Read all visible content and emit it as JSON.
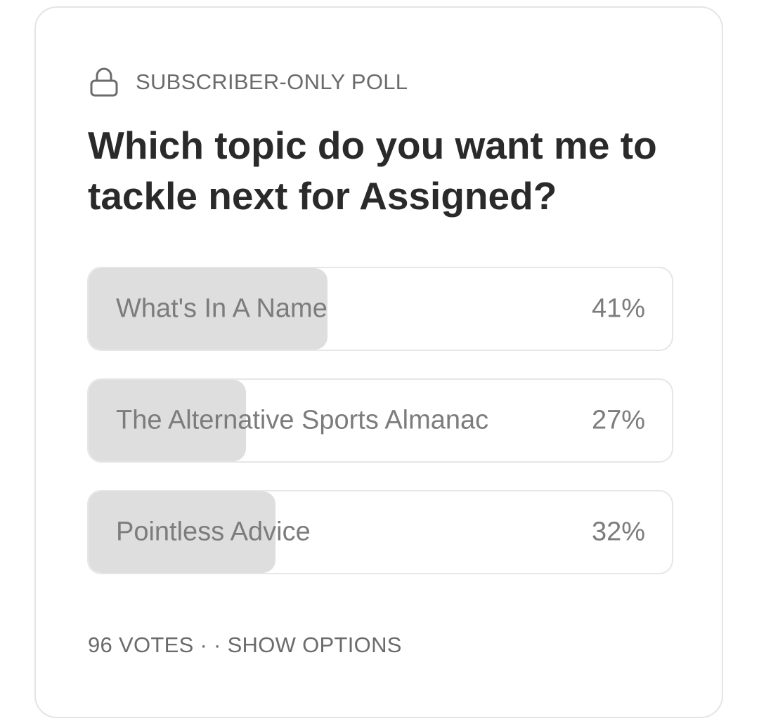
{
  "poll": {
    "label": "SUBSCRIBER-ONLY POLL",
    "lock_icon": "lock-icon",
    "question": "Which topic do you want me to tackle next for Assigned?",
    "options": [
      {
        "label": "What's In A Name",
        "percent_text": "41%",
        "fraction": 0.41
      },
      {
        "label": "The Alternative Sports Almanac",
        "percent_text": "27%",
        "fraction": 0.27
      },
      {
        "label": "Pointless Advice",
        "percent_text": "32%",
        "fraction": 0.32
      }
    ],
    "footer": {
      "votes": "96 VOTES",
      "separator": " · · ",
      "show_options": "SHOW OPTIONS"
    }
  },
  "colors": {
    "fill": "#dedede",
    "option_text": "#7c7c7c",
    "question_text": "#2a2a2a",
    "muted_text": "#6b6b6b",
    "border": "#e4e4e4"
  }
}
